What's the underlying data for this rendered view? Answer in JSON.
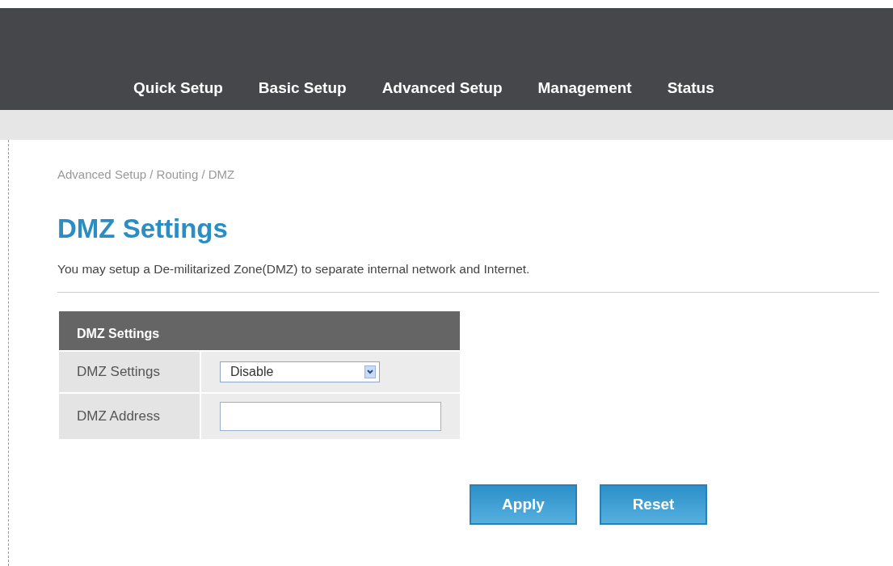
{
  "nav": {
    "items": [
      "Quick Setup",
      "Basic Setup",
      "Advanced Setup",
      "Management",
      "Status"
    ]
  },
  "breadcrumb": "Advanced Setup / Routing / DMZ",
  "title": "DMZ Settings",
  "description": "You may setup a De-militarized Zone(DMZ) to separate internal network and Internet.",
  "table": {
    "header": "DMZ Settings",
    "rows": [
      {
        "kind": "select",
        "label": "DMZ Settings",
        "value": "Disable"
      },
      {
        "kind": "input",
        "label": "DMZ Address"
      }
    ]
  },
  "buttons": [
    "Apply",
    "Reset"
  ]
}
